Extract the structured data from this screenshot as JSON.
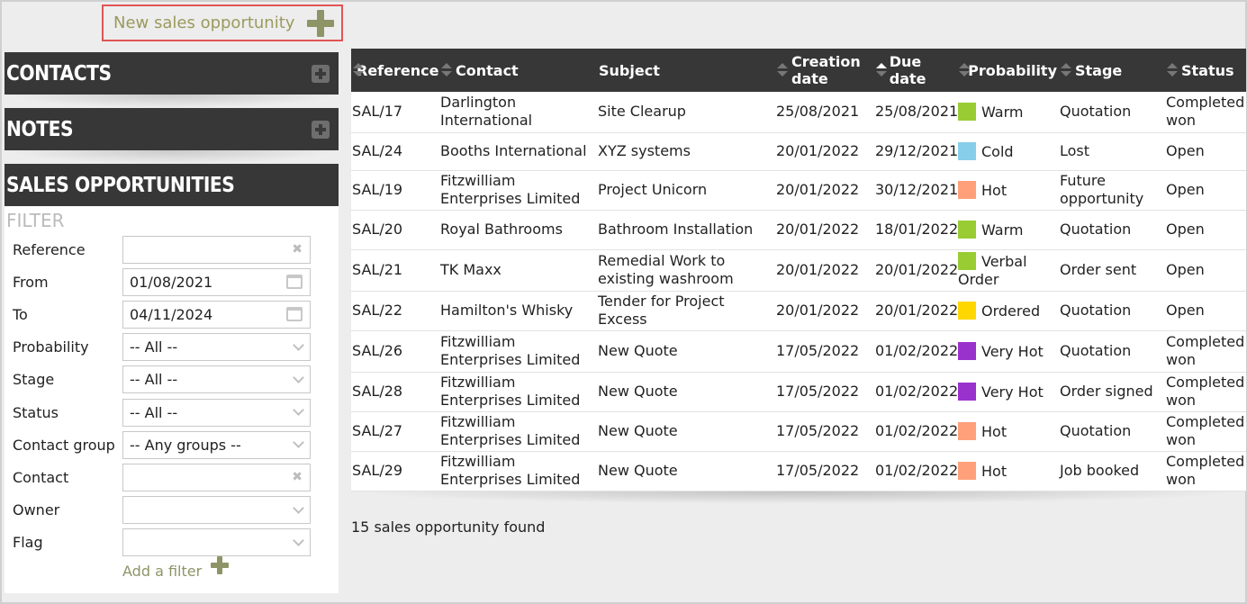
{
  "new_opportunity": {
    "label": "New sales opportunity"
  },
  "sidebar": {
    "contacts_title": "CONTACTS",
    "notes_title": "NOTES",
    "sales_title": "SALES OPPORTUNITIES",
    "filter_title": "FILTER",
    "filters": [
      {
        "label": "Reference",
        "value": "",
        "kind": "clear"
      },
      {
        "label": "From",
        "value": "01/08/2021",
        "kind": "date"
      },
      {
        "label": "To",
        "value": "04/11/2024",
        "kind": "date"
      },
      {
        "label": "Probability",
        "value": "-- All --",
        "kind": "select"
      },
      {
        "label": "Stage",
        "value": "-- All --",
        "kind": "select"
      },
      {
        "label": "Status",
        "value": "-- All --",
        "kind": "select"
      },
      {
        "label": "Contact group",
        "value": "-- Any groups --",
        "kind": "select"
      },
      {
        "label": "Contact",
        "value": "",
        "kind": "clear"
      },
      {
        "label": "Owner",
        "value": "",
        "kind": "select"
      },
      {
        "label": "Flag",
        "value": "",
        "kind": "select"
      }
    ],
    "add_filter_label": "Add a filter"
  },
  "table": {
    "headers": {
      "reference": "Reference",
      "contact": "Contact",
      "subject": "Subject",
      "creation_date": "Creation date",
      "due_date": "Due date",
      "probability": "Probability",
      "stage": "Stage",
      "status": "Status"
    },
    "probability_colors": {
      "Warm": "#99cc33",
      "Cold": "#87ceeb",
      "Hot": "#ffa07a",
      "Verbal Order": "#99cc33",
      "Ordered": "#ffd700",
      "Very Hot": "#9932cc"
    },
    "rows": [
      {
        "reference": "SAL/17",
        "contact": "Darlington International",
        "subject": "Site Clearup",
        "creation_date": "25/08/2021",
        "due_date": "25/08/2021",
        "probability": "Warm",
        "stage": "Quotation",
        "status": "Completed won"
      },
      {
        "reference": "SAL/24",
        "contact": "Booths International",
        "subject": "XYZ systems",
        "creation_date": "20/01/2022",
        "due_date": "29/12/2021",
        "probability": "Cold",
        "stage": "Lost",
        "status": "Open"
      },
      {
        "reference": "SAL/19",
        "contact": "Fitzwilliam Enterprises Limited",
        "subject": "Project Unicorn",
        "creation_date": "20/01/2022",
        "due_date": "30/12/2021",
        "probability": "Hot",
        "stage": "Future opportunity",
        "status": "Open"
      },
      {
        "reference": "SAL/20",
        "contact": "Royal Bathrooms",
        "subject": "Bathroom Installation",
        "creation_date": "20/01/2022",
        "due_date": "18/01/2022",
        "probability": "Warm",
        "stage": "Quotation",
        "status": "Open"
      },
      {
        "reference": "SAL/21",
        "contact": "TK Maxx",
        "subject": "Remedial Work to existing washroom",
        "creation_date": "20/01/2022",
        "due_date": "20/01/2022",
        "probability": "Verbal Order",
        "stage": "Order sent",
        "status": "Open"
      },
      {
        "reference": "SAL/22",
        "contact": "Hamilton's Whisky",
        "subject": "Tender for Project Excess",
        "creation_date": "20/01/2022",
        "due_date": "20/01/2022",
        "probability": "Ordered",
        "stage": "Quotation",
        "status": "Open"
      },
      {
        "reference": "SAL/26",
        "contact": "Fitzwilliam Enterprises Limited",
        "subject": "New Quote",
        "creation_date": "17/05/2022",
        "due_date": "01/02/2022",
        "probability": "Very Hot",
        "stage": "Quotation",
        "status": "Completed won"
      },
      {
        "reference": "SAL/28",
        "contact": "Fitzwilliam Enterprises Limited",
        "subject": "New Quote",
        "creation_date": "17/05/2022",
        "due_date": "01/02/2022",
        "probability": "Very Hot",
        "stage": "Order signed",
        "status": "Completed won"
      },
      {
        "reference": "SAL/27",
        "contact": "Fitzwilliam Enterprises Limited",
        "subject": "New Quote",
        "creation_date": "17/05/2022",
        "due_date": "01/02/2022",
        "probability": "Hot",
        "stage": "Quotation",
        "status": "Completed won"
      },
      {
        "reference": "SAL/29",
        "contact": "Fitzwilliam Enterprises Limited",
        "subject": "New Quote",
        "creation_date": "17/05/2022",
        "due_date": "01/02/2022",
        "probability": "Hot",
        "stage": "Job booked",
        "status": "Completed won"
      }
    ],
    "found_text": "15 sales opportunity found"
  }
}
